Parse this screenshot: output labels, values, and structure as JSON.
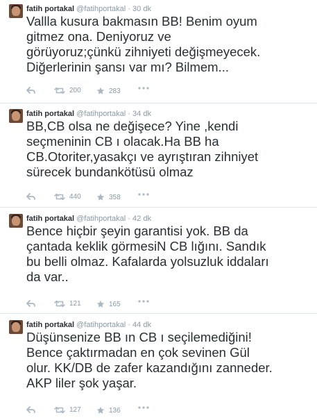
{
  "tweets": [
    {
      "name": "fatih portakal",
      "handle": "@fatihportakal",
      "dot": "·",
      "time": "30 dk",
      "lines": [
        "Vallla kusura bakmasın BB! Benim oyum",
        "gitmez ona. Deniyoruz ve",
        "görüyoruz;çünkü zihniyeti değişmeyecek.",
        "Diğerlerinin şansı var mı? Bilmem..."
      ],
      "retweets": "200",
      "favorites": "283"
    },
    {
      "name": "fatih portakal",
      "handle": "@fatihportakal",
      "dot": "·",
      "time": "34 dk",
      "lines": [
        "BB,CB olsa ne değişece? Yine ,kendi",
        "seçmeninin CB ı olacak.Ha BB ha",
        "CB.Otoriter,yasakçı ve ayrıştıran zihniyet",
        "sürecek bundankötüsü olmaz"
      ],
      "retweets": "440",
      "favorites": "358"
    },
    {
      "name": "fatih portakal",
      "handle": "@fatihportakal",
      "dot": "·",
      "time": "42 dk",
      "lines": [
        "Bence hiçbir şeyin garantisi yok. BB da",
        "çantada keklik görmesiN CB lığını. Sandık",
        "bu belli olmaz. Kafalarda yolsuzluk iddaları",
        "da var.."
      ],
      "retweets": "121",
      "favorites": "165"
    },
    {
      "name": "fatih portakal",
      "handle": "@fatihportakal",
      "dot": "·",
      "time": "44 dk",
      "lines": [
        "Düşünsenize BB ın CB ı seçilemediğini!",
        "Bence çaktırmadan en çok sevinen Gül",
        "olur. KK/DB de zafer kazandığını zanneder.",
        "AKP liler şok yaşar."
      ],
      "retweets": "127",
      "favorites": "136"
    }
  ]
}
